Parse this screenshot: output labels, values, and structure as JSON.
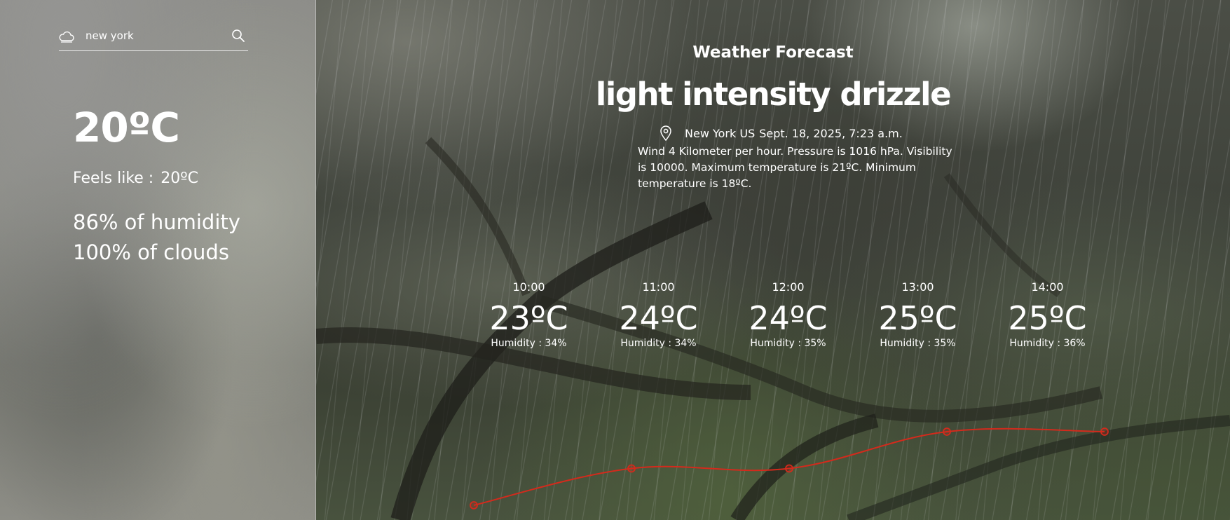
{
  "search": {
    "value": "new york",
    "icon_left": "cloud-icon",
    "icon_right": "search-icon"
  },
  "current": {
    "temperature": "20ºC",
    "feels_like_label": "Feels like :",
    "feels_like_value": "20ºC",
    "humidity": "86% of humidity",
    "clouds": "100% of clouds"
  },
  "header": {
    "title": "Weather Forecast",
    "condition": "light intensity drizzle",
    "location": "New York US",
    "datetime": "Sept. 18, 2025, 7:23 a.m.",
    "description": "Wind 4 Kilometer per hour. Pressure is 1016 hPa. Visibility is 10000. Maximum temperature is 21ºC. Minimum temperature is 18ºC."
  },
  "forecast": [
    {
      "time": "10:00",
      "temp": "23ºC",
      "humidity": "Humidity : 34%"
    },
    {
      "time": "11:00",
      "temp": "24ºC",
      "humidity": "Humidity : 34%"
    },
    {
      "time": "12:00",
      "temp": "24ºC",
      "humidity": "Humidity : 35%"
    },
    {
      "time": "13:00",
      "temp": "25ºC",
      "humidity": "Humidity : 35%"
    },
    {
      "time": "14:00",
      "temp": "25ºC",
      "humidity": "Humidity : 36%"
    }
  ],
  "chart_data": {
    "type": "line",
    "x": [
      "10:00",
      "11:00",
      "12:00",
      "13:00",
      "14:00"
    ],
    "series": [
      {
        "values": [
          23,
          24,
          24,
          25,
          25
        ]
      }
    ],
    "color": "#d42a1c",
    "grid": false
  },
  "colors": {
    "text": "#ffffff",
    "trend_line": "#d42a1c"
  }
}
